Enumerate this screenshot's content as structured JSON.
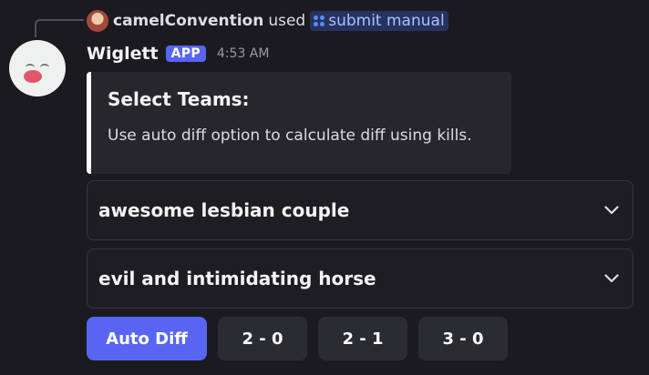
{
  "reply": {
    "user": "camelConvention",
    "used_text": "used",
    "command": "submit manual"
  },
  "message": {
    "author": "Wiglett",
    "badge": "APP",
    "timestamp": "4:53 AM"
  },
  "embed": {
    "title": "Select Teams:",
    "description": "Use auto diff option to calculate diff using kills."
  },
  "selects": [
    {
      "value": "awesome lesbian couple"
    },
    {
      "value": "evil and intimidating horse"
    }
  ],
  "buttons": [
    {
      "label": "Auto Diff",
      "style": "primary"
    },
    {
      "label": "2 - 0",
      "style": "secondary"
    },
    {
      "label": "2 - 1",
      "style": "secondary"
    },
    {
      "label": "3 - 0",
      "style": "secondary"
    }
  ],
  "colors": {
    "background": "#1b1b1f",
    "blurple": "#5865f2",
    "embed_bg": "#26262b",
    "embed_accent": "#ffffff",
    "secondary_button": "#2b2c31",
    "muted_text": "#949ba4"
  },
  "icons": {
    "command": "slash-command-icon",
    "select_chevron": "chevron-down-icon"
  }
}
